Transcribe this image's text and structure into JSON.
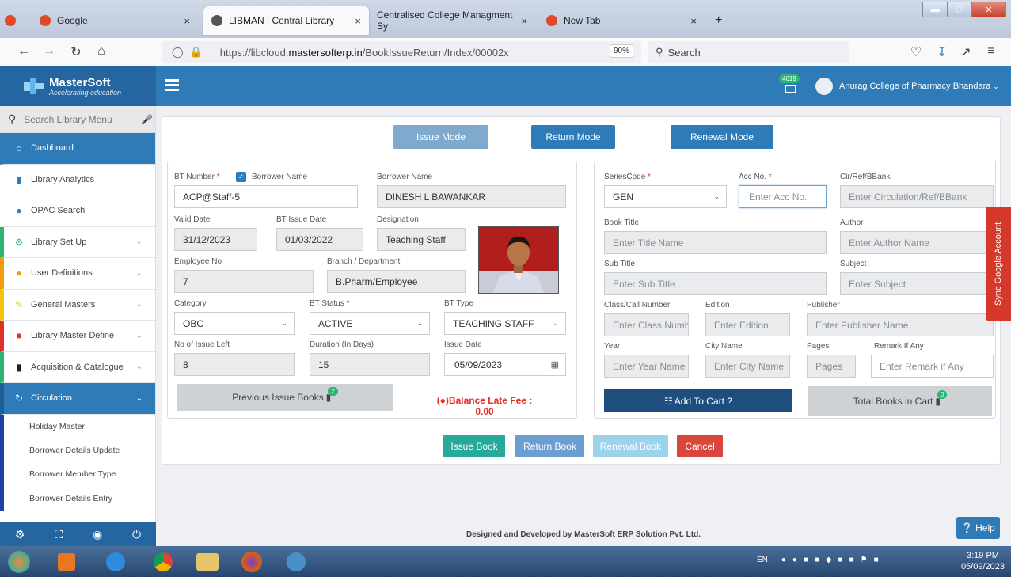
{
  "browser": {
    "tabs": [
      {
        "label": "Google",
        "color": "#e04a2b"
      },
      {
        "label": "LIBMAN | Central Library",
        "color": "#555555"
      },
      {
        "label": "Centralised College Managment Sy",
        "color": ""
      },
      {
        "label": "New Tab",
        "color": "#e04a2b"
      }
    ],
    "tab_close": "×",
    "new_tab": "+",
    "url_prefix": "https://libcloud.",
    "url_host": "mastersofterp.in",
    "url_path": "/BookIssueReturn/Index/00002x",
    "zoom": "90%",
    "search_placeholder": "Search"
  },
  "header": {
    "brand": "MasterSoft",
    "tagline": "Accelerating education",
    "notif_count": "4619",
    "user": "Anurag College of Pharmacy Bhandara"
  },
  "sidebar": {
    "search_placeholder": "Search Library Menu",
    "items": [
      {
        "label": "Dashboard",
        "icon": "home-icon"
      },
      {
        "label": "Library Analytics",
        "icon": "bar-chart-icon"
      },
      {
        "label": "OPAC Search",
        "icon": "globe-icon"
      },
      {
        "label": "Library Set Up",
        "icon": "gears-icon"
      },
      {
        "label": "User Definitions",
        "icon": "users-icon"
      },
      {
        "label": "General Masters",
        "icon": "edit-icon"
      },
      {
        "label": "Library Master Define",
        "icon": "cubes-icon"
      },
      {
        "label": "Acquisition & Catalogue",
        "icon": "book-icon"
      },
      {
        "label": "Circulation",
        "icon": "refresh-icon"
      }
    ],
    "sub_items": [
      "Holiday Master",
      "Borrower Details Update",
      "Borrower Member Type",
      "Borrower Details Entry"
    ]
  },
  "modes": {
    "issue": "Issue Mode",
    "return": "Return Mode",
    "renewal": "Renewal Mode"
  },
  "borrower": {
    "bt_number_label": "BT Number",
    "borrower_name_check_label": "Borrower Name",
    "bt_number": "ACP@Staff-5",
    "borrower_name_label": "Borrower Name",
    "borrower_name": "DINESH L BAWANKAR",
    "valid_date_label": "Valid Date",
    "valid_date": "31/12/2023",
    "bt_issue_date_label": "BT Issue Date",
    "bt_issue_date": "01/03/2022",
    "designation_label": "Designation",
    "designation": "Teaching Staff",
    "employee_no_label": "Employee No",
    "employee_no": "7",
    "branch_label": "Branch / Department",
    "branch": "B.Pharm/Employee",
    "category_label": "Category",
    "category": "OBC",
    "bt_status_label": "BT Status",
    "bt_status": "ACTIVE",
    "bt_type_label": "BT Type",
    "bt_type": "TEACHING STAFF",
    "issue_left_label": "No of Issue Left",
    "issue_left": "8",
    "duration_label": "Duration (In Days)",
    "duration": "15",
    "issue_date_label": "Issue Date",
    "issue_date": "05/09/2023",
    "prev_books": "Previous Issue Books",
    "prev_count": "2",
    "balance_label": "Balance Late Fee :",
    "balance": "0.00"
  },
  "book": {
    "series_label": "SeriesCode",
    "series": "GEN",
    "acc_label": "Acc No.",
    "acc_ph": "Enter Acc No.",
    "cir_label": "Cir/Ref/BBank",
    "cir_ph": "Enter Circulation/Ref/BBank",
    "title_label": "Book Title",
    "title_ph": "Enter Title Name",
    "author_label": "Author",
    "author_ph": "Enter Author Name",
    "subtitle_label": "Sub Title",
    "subtitle_ph": "Enter Sub Title",
    "subject_label": "Subject",
    "subject_ph": "Enter Subject",
    "class_label": "Class/Call Number",
    "class_ph": "Enter Class Numb",
    "edition_label": "Edition",
    "edition_ph": "Enter Edition",
    "publisher_label": "Publisher",
    "publisher_ph": "Enter Publisher Name",
    "year_label": "Year",
    "year_ph": "Enter Year Name",
    "city_label": "City Name",
    "city_ph": "Enter City Name",
    "pages_label": "Pages",
    "pages_ph": "Pages",
    "remark_label": "Remark If Any",
    "remark_ph": "Enter Remark if Any",
    "add_cart": "Add To Cart ?",
    "total_cart": "Total Books in Cart",
    "cart_count": "0"
  },
  "actions": {
    "issue": "Issue Book",
    "return": "Return Book",
    "renewal": "Renewal Book",
    "cancel": "Cancel"
  },
  "footer": "Designed and Developed by MasterSoft ERP Solution Pvt. Ltd.",
  "sync": "Sync Google Account",
  "help": "Help",
  "taskbar": {
    "lang": "EN",
    "time": "3:19 PM",
    "date": "05/09/2023"
  },
  "colors": {
    "primary": "#2e7bb8",
    "green": "#2bb673",
    "red": "#d6392c",
    "navy": "#1e4e7e"
  }
}
